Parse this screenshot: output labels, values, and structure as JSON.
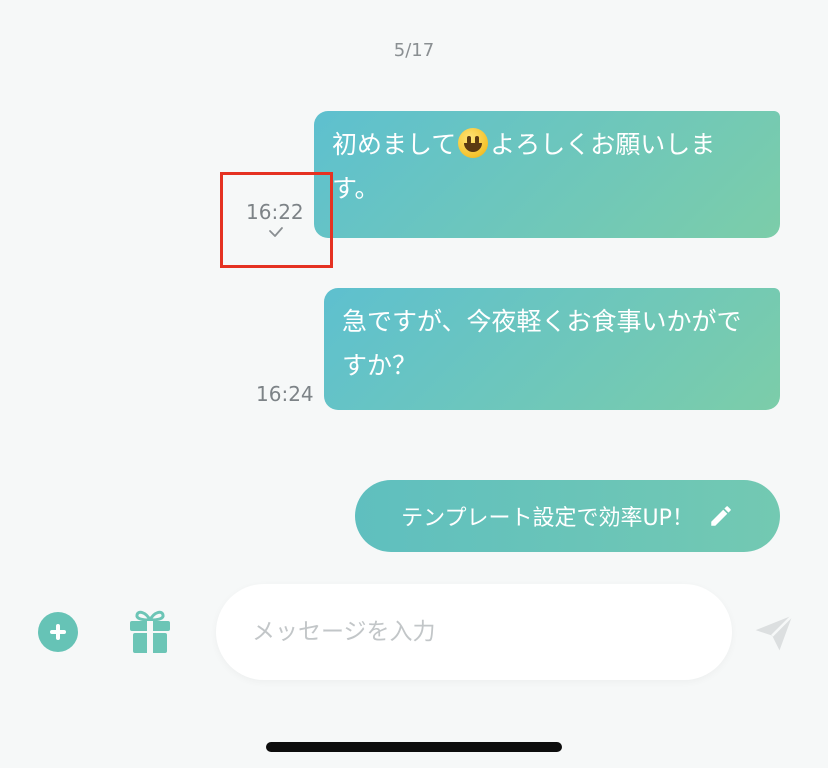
{
  "chat": {
    "date": "5/17",
    "messages": [
      {
        "text_before": "初めまして",
        "emoji": "grinning-face-emoji",
        "text_after": "よろしくお願いします。",
        "time": "16:22",
        "status": "check-icon"
      },
      {
        "text": "急ですが、今夜軽くお食事いかがですか？",
        "time": "16:24"
      }
    ],
    "template_button_label": "テンプレート設定で効率UP！"
  },
  "composer": {
    "placeholder": "メッセージを入力",
    "value": ""
  },
  "colors": {
    "bubble_gradient_start": "#5ec0cf",
    "bubble_gradient_end": "#7ccda9",
    "accent": "#66c3b6",
    "highlight_box": "#e53222"
  }
}
